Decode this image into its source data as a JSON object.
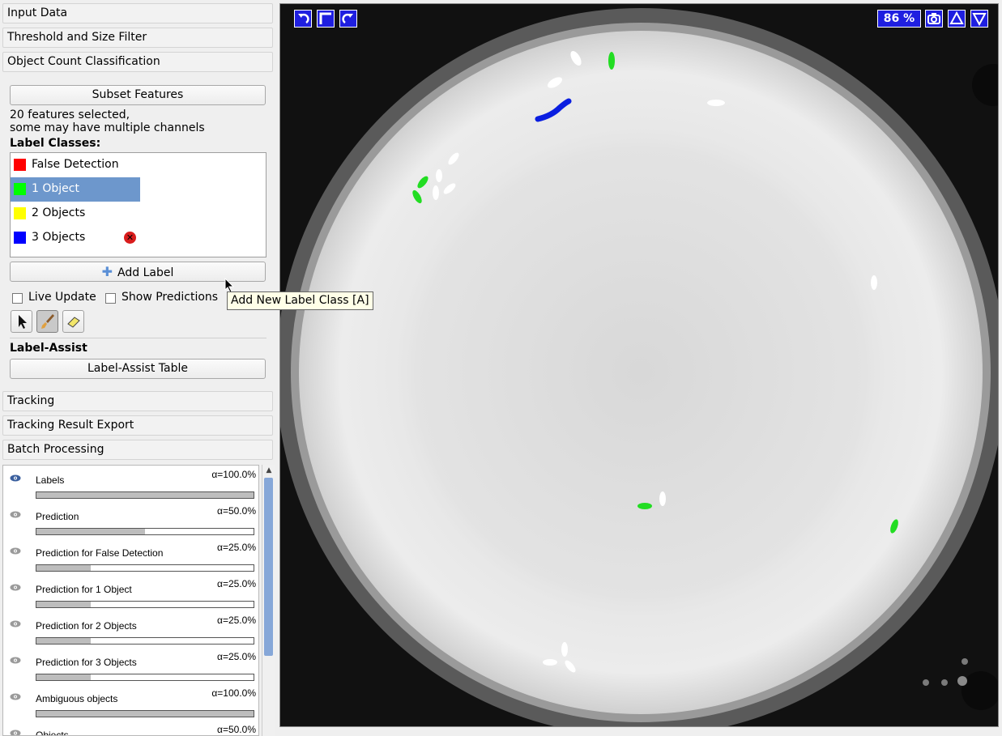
{
  "applets": {
    "input_data": "Input Data",
    "threshold": "Threshold and Size Filter",
    "object_count": "Object Count Classification",
    "tracking": "Tracking",
    "tracking_export": "Tracking Result Export",
    "batch": "Batch Processing"
  },
  "classification": {
    "subset_button": "Subset Features",
    "features_line1": "20 features selected,",
    "features_line2": "some may have multiple channels",
    "label_classes_title": "Label Classes:",
    "classes": [
      {
        "name": "False Detection",
        "color": "#ff0000"
      },
      {
        "name": "1 Object",
        "color": "#00ff00"
      },
      {
        "name": "2 Objects",
        "color": "#ffff00"
      },
      {
        "name": "3 Objects",
        "color": "#0000ff"
      }
    ],
    "add_label_button": "Add Label",
    "live_update": "Live Update",
    "show_predictions": "Show Predictions",
    "label_assist_title": "Label-Assist",
    "label_assist_button": "Label-Assist Table"
  },
  "layers": [
    {
      "name": "Labels",
      "alpha": "α=100.0%",
      "value": 1.0
    },
    {
      "name": "Prediction",
      "alpha": "α=50.0%",
      "value": 0.5
    },
    {
      "name": "Prediction for False Detection",
      "alpha": "α=25.0%",
      "value": 0.25
    },
    {
      "name": "Prediction for 1 Object",
      "alpha": "α=25.0%",
      "value": 0.25
    },
    {
      "name": "Prediction for 2 Objects",
      "alpha": "α=25.0%",
      "value": 0.25
    },
    {
      "name": "Prediction for 3 Objects",
      "alpha": "α=25.0%",
      "value": 0.25
    },
    {
      "name": "Ambiguous objects",
      "alpha": "α=100.0%",
      "value": 1.0
    },
    {
      "name": "Objects",
      "alpha": "α=50.0%",
      "value": 0.5
    }
  ],
  "viewer": {
    "zoom": "86 %",
    "undo_icon": "undo-icon",
    "reset_icon": "corner-icon",
    "redo_icon": "redo-icon",
    "camera_icon": "camera-icon",
    "up_icon": "triangle-up-icon",
    "down_icon": "triangle-down-icon"
  },
  "tooltip": "Add New Label Class [A]"
}
